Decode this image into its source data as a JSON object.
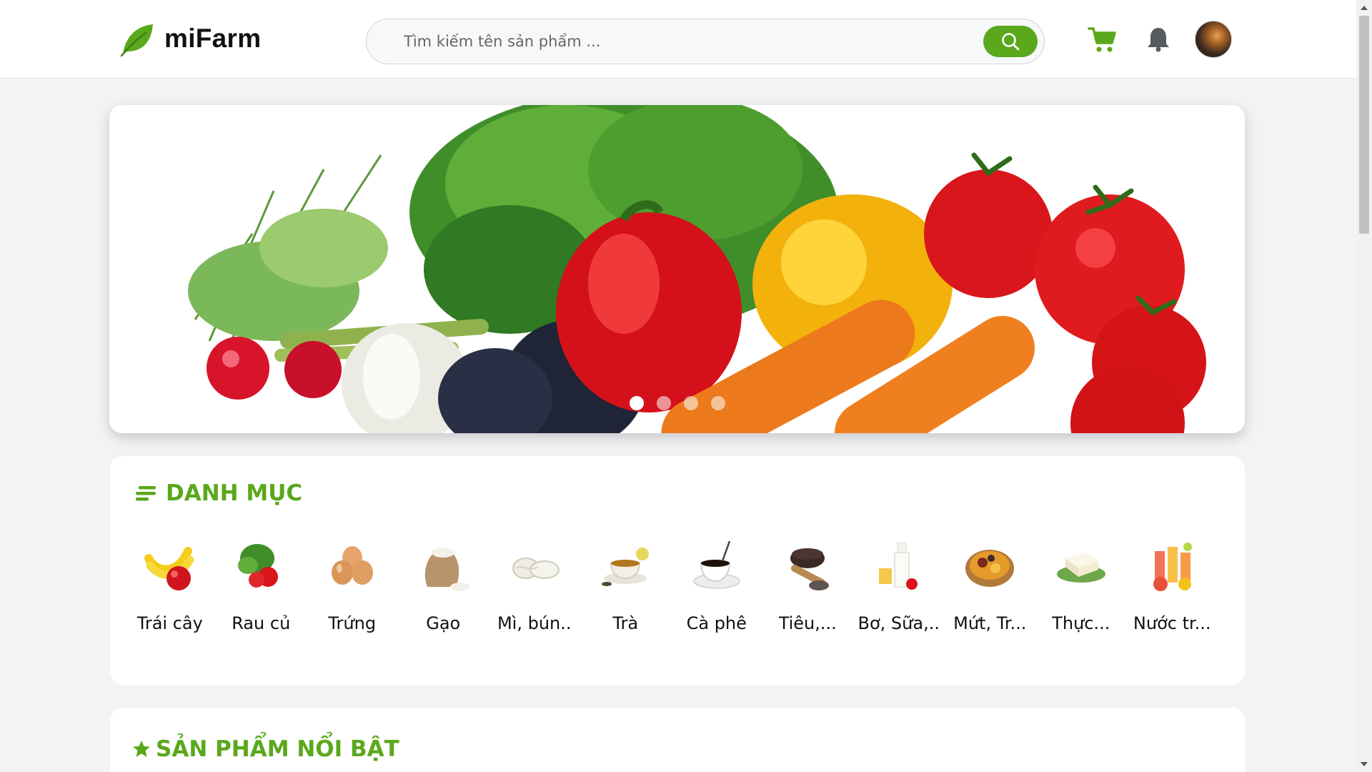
{
  "header": {
    "brand": "miFarm",
    "search_placeholder": "Tìm kiếm tên sản phẩm ...",
    "icons": [
      "leaf-logo-icon",
      "search-icon",
      "cart-icon",
      "bell-icon"
    ]
  },
  "banner": {
    "slide_count": 4,
    "active_slide": 1
  },
  "categories": {
    "title": "DANH MỤC",
    "items": [
      {
        "label": "Trái cây",
        "icon": "fruit-icon"
      },
      {
        "label": "Rau củ",
        "icon": "vegetable-icon"
      },
      {
        "label": "Trứng",
        "icon": "egg-icon"
      },
      {
        "label": "Gạo",
        "icon": "rice-icon"
      },
      {
        "label": "Mì, bún..",
        "icon": "noodle-icon"
      },
      {
        "label": "Trà",
        "icon": "tea-icon"
      },
      {
        "label": "Cà phê",
        "icon": "coffee-icon"
      },
      {
        "label": "Tiêu,...",
        "icon": "pepper-icon"
      },
      {
        "label": "Bơ, Sữa,..",
        "icon": "dairy-icon"
      },
      {
        "label": "Mứt, Tr...",
        "icon": "dried-fruit-icon"
      },
      {
        "label": "Thực...",
        "icon": "tofu-icon"
      },
      {
        "label": "Nước tr...",
        "icon": "juice-icon"
      }
    ]
  },
  "featured": {
    "title": "SẢN PHẨM NỔI BẬT"
  },
  "colors": {
    "brand_green": "#5aa81b",
    "background": "#f2f3f5"
  }
}
